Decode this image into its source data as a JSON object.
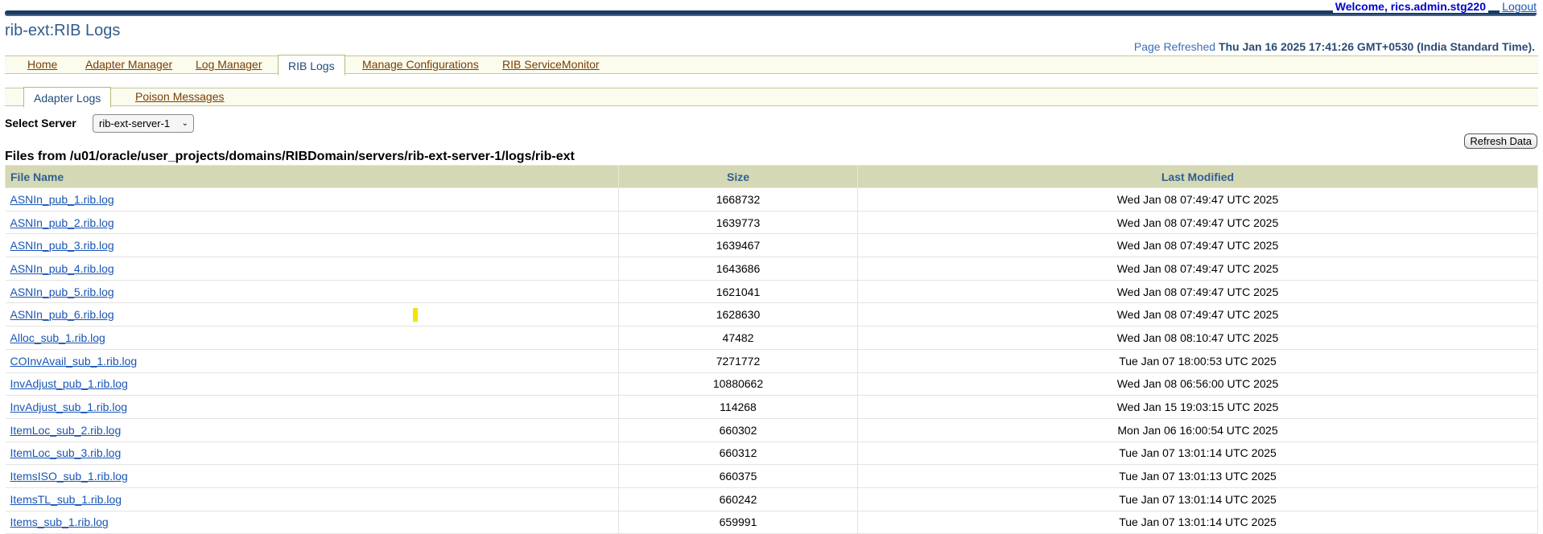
{
  "header": {
    "welcome": "Welcome, rics.admin.stg220",
    "logout": "Logout",
    "app_title": "rib-ext:RIB Logs",
    "refreshed_label": "Page Refreshed",
    "refreshed_time": "Thu Jan 16 2025 17:41:26 GMT+0530 (India Standard Time)."
  },
  "primary_tabs": [
    {
      "label": "Home"
    },
    {
      "label": "Adapter Manager"
    },
    {
      "label": "Log Manager"
    },
    {
      "label": "RIB Logs"
    },
    {
      "label": "Manage Configurations"
    },
    {
      "label": "RIB ServiceMonitor"
    }
  ],
  "secondary_tabs": [
    {
      "label": "Adapter Logs"
    },
    {
      "label": "Poison Messages"
    }
  ],
  "server": {
    "label": "Select Server",
    "selected": "rib-ext-server-1"
  },
  "refresh_button": "Refresh Data",
  "files_heading": "Files from /u01/oracle/user_projects/domains/RIBDomain/servers/rib-ext-server-1/logs/rib-ext",
  "table": {
    "columns": [
      "File Name",
      "Size",
      "Last Modified"
    ],
    "rows": [
      {
        "name": "ASNIn_pub_1.rib.log",
        "size": "1668732",
        "modified": "Wed Jan 08 07:49:47 UTC 2025"
      },
      {
        "name": "ASNIn_pub_2.rib.log",
        "size": "1639773",
        "modified": "Wed Jan 08 07:49:47 UTC 2025"
      },
      {
        "name": "ASNIn_pub_3.rib.log",
        "size": "1639467",
        "modified": "Wed Jan 08 07:49:47 UTC 2025"
      },
      {
        "name": "ASNIn_pub_4.rib.log",
        "size": "1643686",
        "modified": "Wed Jan 08 07:49:47 UTC 2025"
      },
      {
        "name": "ASNIn_pub_5.rib.log",
        "size": "1621041",
        "modified": "Wed Jan 08 07:49:47 UTC 2025"
      },
      {
        "name": "ASNIn_pub_6.rib.log",
        "size": "1628630",
        "modified": "Wed Jan 08 07:49:47 UTC 2025"
      },
      {
        "name": "Alloc_sub_1.rib.log",
        "size": "47482",
        "modified": "Wed Jan 08 08:10:47 UTC 2025"
      },
      {
        "name": "COInvAvail_sub_1.rib.log",
        "size": "7271772",
        "modified": "Tue Jan 07 18:00:53 UTC 2025"
      },
      {
        "name": "InvAdjust_pub_1.rib.log",
        "size": "10880662",
        "modified": "Wed Jan 08 06:56:00 UTC 2025"
      },
      {
        "name": "InvAdjust_sub_1.rib.log",
        "size": "114268",
        "modified": "Wed Jan 15 19:03:15 UTC 2025"
      },
      {
        "name": "ItemLoc_sub_2.rib.log",
        "size": "660302",
        "modified": "Mon Jan 06 16:00:54 UTC 2025"
      },
      {
        "name": "ItemLoc_sub_3.rib.log",
        "size": "660312",
        "modified": "Tue Jan 07 13:01:14 UTC 2025"
      },
      {
        "name": "ItemsISO_sub_1.rib.log",
        "size": "660375",
        "modified": "Tue Jan 07 13:01:13 UTC 2025"
      },
      {
        "name": "ItemsTL_sub_1.rib.log",
        "size": "660242",
        "modified": "Tue Jan 07 13:01:14 UTC 2025"
      },
      {
        "name": "Items_sub_1.rib.log",
        "size": "659991",
        "modified": "Tue Jan 07 13:01:14 UTC 2025"
      }
    ]
  },
  "colors": {
    "title": "#305c8c",
    "header_bg": "#d5d8b4",
    "link": "#1a55b5",
    "tab_link": "#7a3e00",
    "marker": "#f2e600"
  }
}
